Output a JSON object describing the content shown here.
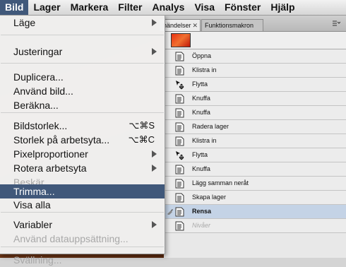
{
  "menubar": {
    "items": [
      "Bild",
      "Lager",
      "Markera",
      "Filter",
      "Analys",
      "Visa",
      "Fönster",
      "Hjälp"
    ],
    "active_index": 0
  },
  "dropdown": {
    "items": [
      {
        "label": "Läge",
        "submenu": true
      },
      {
        "label": "Justeringar",
        "submenu": true
      },
      {
        "label": "Duplicera..."
      },
      {
        "label": "Använd bild..."
      },
      {
        "label": "Beräkna..."
      },
      {
        "label": "Bildstorlek...",
        "shortcut": "⌥⌘S"
      },
      {
        "label": "Storlek på arbetsyta...",
        "shortcut": "⌥⌘C"
      },
      {
        "label": "Pixelproportioner",
        "submenu": true
      },
      {
        "label": "Rotera arbetsyta",
        "submenu": true
      },
      {
        "label": "Beskär",
        "disabled": true
      },
      {
        "label": "Trimma...",
        "highlighted": true
      },
      {
        "label": "Visa alla"
      },
      {
        "label": "Variabler",
        "submenu": true
      },
      {
        "label": "Använd datauppsättning...",
        "disabled": true
      },
      {
        "label": "Svällning...",
        "disabled": true
      }
    ]
  },
  "panel": {
    "tab_active": "händelser",
    "tab_active_close": "✕",
    "tab_inactive": "Funktionsmakron",
    "history": [
      {
        "label": "Öppna",
        "icon": "document-icon"
      },
      {
        "label": "Klistra in",
        "icon": "document-icon"
      },
      {
        "label": "Flytta",
        "icon": "move-icon"
      },
      {
        "label": "Knuffa",
        "icon": "document-icon"
      },
      {
        "label": "Knuffa",
        "icon": "document-icon"
      },
      {
        "label": "Radera lager",
        "icon": "document-icon"
      },
      {
        "label": "Klistra in",
        "icon": "document-icon"
      },
      {
        "label": "Flytta",
        "icon": "move-icon"
      },
      {
        "label": "Knuffa",
        "icon": "document-icon"
      },
      {
        "label": "Lägg samman neråt",
        "icon": "document-icon"
      },
      {
        "label": "Skapa lager",
        "icon": "document-icon"
      },
      {
        "label": "Rensa",
        "icon": "document-icon",
        "selected": true
      },
      {
        "label": "Nivåer",
        "icon": "document-icon",
        "dimmed": true
      }
    ]
  },
  "colors": {
    "highlight": "#40587a",
    "selected_row": "#c4d3e6"
  }
}
